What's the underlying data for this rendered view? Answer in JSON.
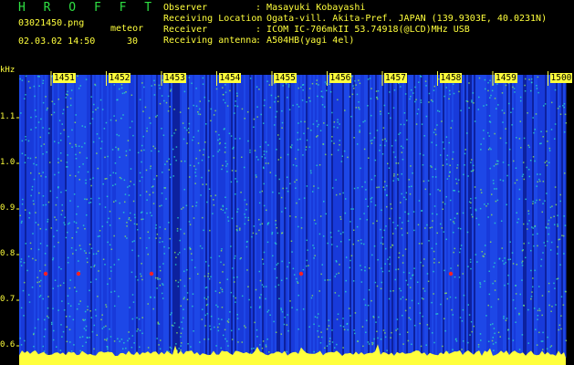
{
  "header": {
    "app_title": "H R O F F T",
    "file_name": "03021450.png",
    "datetime": "02.03.02 14:50",
    "meteor_label": "meteor",
    "meteor_count": "30"
  },
  "station": {
    "fields": [
      {
        "key": "Observer",
        "value": "Masayuki Kobayashi"
      },
      {
        "key": "Receiving Location",
        "value": "Ogata-vill. Akita-Pref. JAPAN (139.9303E, 40.0231N)"
      },
      {
        "key": "Receiver",
        "value": "ICOM IC-706mkII 53.74918(@LCD)MHz USB"
      },
      {
        "key": "Receiving antenna",
        "value": "A504HB(yagi 4el)"
      }
    ]
  },
  "chart_data": {
    "type": "heatmap",
    "ylabel": "kHz",
    "y_ticks": [
      "1.1",
      "1.0",
      "0.9",
      "0.8",
      "0.7",
      "0.6"
    ],
    "x_ticks": [
      "1451",
      "1452",
      "1453",
      "1454",
      "1455",
      "1456",
      "1457",
      "1458",
      "1459",
      "1500"
    ],
    "colors": {
      "background": "#1a3cf0",
      "accent": "#ffff3c",
      "echo": "#ff2020",
      "noise": "#2bd4c8"
    }
  }
}
